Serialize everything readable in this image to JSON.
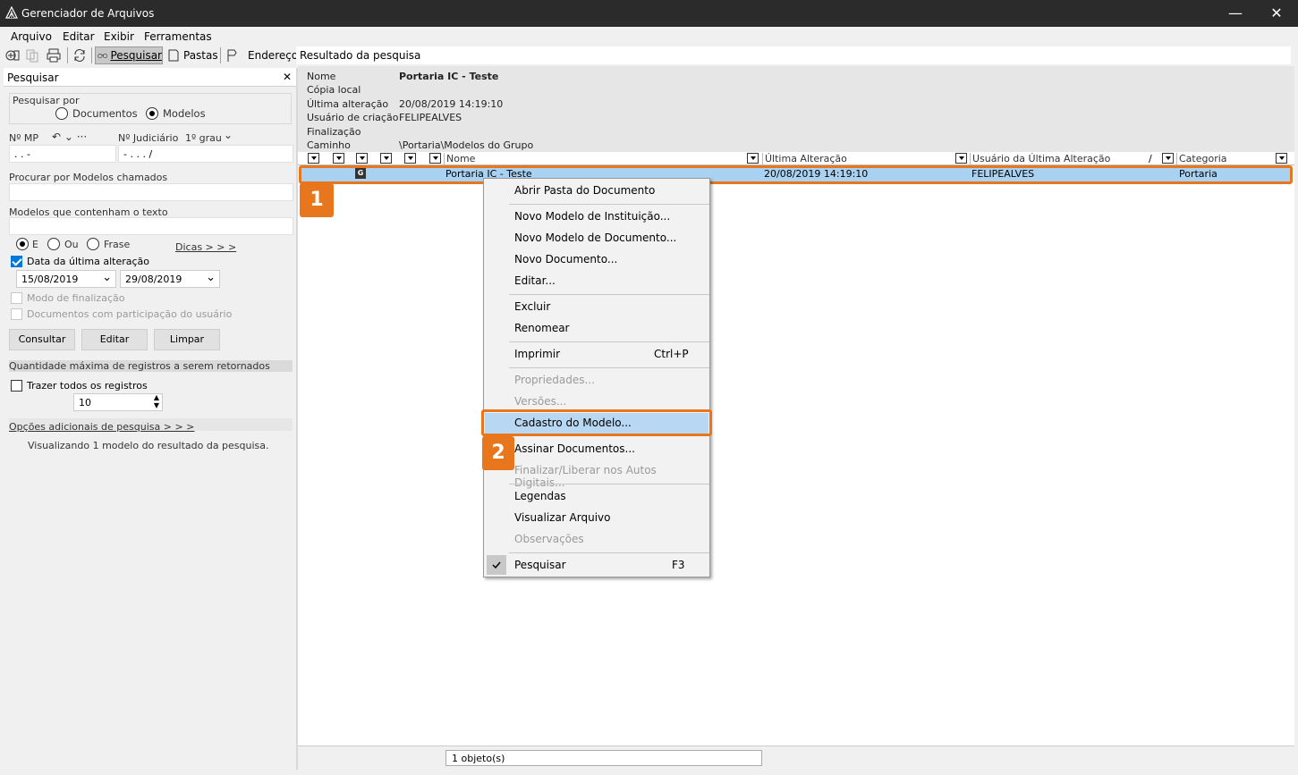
{
  "window": {
    "title": "Gerenciador de Arquivos",
    "minimize": "—",
    "close": "✕"
  },
  "menu": [
    {
      "label": "Arquivo"
    },
    {
      "label": "Editar"
    },
    {
      "label": "Exibir"
    },
    {
      "label": "Ferramentas"
    }
  ],
  "toolbar": {
    "search": "Pesquisar",
    "folders": "Pastas",
    "address_label": "Endereço",
    "address_value": "Resultado da pesquisa"
  },
  "left": {
    "panel_title": "Pesquisar",
    "search_by": "Pesquisar por",
    "opt_documents": "Documentos",
    "opt_models": "Modelos",
    "mp_label": "Nº MP",
    "mp_value": "  .   .     -",
    "judiciario_label": "Nº Judiciário",
    "grau": "1º grau",
    "judiciario_value": "      -   .   .  .     /",
    "search_name_label": "Procurar por Modelos chamados",
    "contains_label": "Modelos que contenham o texto",
    "opt_e": "E",
    "opt_ou": "Ou",
    "opt_frase": "Frase",
    "tips": "Dicas > > >",
    "last_change_label": "Data da última alteração",
    "date_from": "15/08/2019",
    "date_to": "29/08/2019",
    "finalization_label": "Modo de finalização",
    "participation_label": "Documentos com participação do usuário",
    "btn_query": "Consultar",
    "btn_edit": "Editar",
    "btn_clear": "Limpar",
    "max_records": "Quantidade máxima de registros a serem retornados",
    "bring_all": "Trazer todos os registros",
    "limit": "10",
    "more_options": "Opções adicionais de pesquisa > > >",
    "result_info": "Visualizando 1 modelo do resultado da pesquisa."
  },
  "info": {
    "name_k": "Nome",
    "name_v": "Portaria IC - Teste",
    "copy_k": "Cópia local",
    "last_k": "Última alteração",
    "last_v": "20/08/2019 14:19:10",
    "user_k": "Usuário de criação",
    "user_v": "FELIPEALVES",
    "final_k": "Finalização",
    "path_k": "Caminho",
    "path_v": "\\Portaria\\Modelos do Grupo"
  },
  "table": {
    "columns": [
      "Nome",
      "Última Alteração",
      "Usuário da Última Alteração",
      "Categoria"
    ],
    "rows": [
      {
        "icon": "G",
        "name": "Portaria IC - Teste",
        "date": "20/08/2019 14:19:10",
        "user": "FELIPEALVES",
        "category": "Portaria"
      }
    ]
  },
  "status": "1 objeto(s)",
  "context_menu": [
    {
      "label": "Abrir Pasta do Documento"
    },
    {
      "label": "Novo Modelo de Instituição..."
    },
    {
      "label": "Novo Modelo de Documento..."
    },
    {
      "label": "Novo Documento..."
    },
    {
      "label": "Editar..."
    },
    {
      "label": "Excluir"
    },
    {
      "label": "Renomear"
    },
    {
      "label": "Imprimir",
      "shortcut": "Ctrl+P"
    },
    {
      "label": "Propriedades..."
    },
    {
      "label": "Versões..."
    },
    {
      "label": "Cadastro do Modelo..."
    },
    {
      "label": "Assinar Documentos..."
    },
    {
      "label": "Finalizar/Liberar nos Autos Digitais..."
    },
    {
      "label": "Legendas"
    },
    {
      "label": "Visualizar Arquivo"
    },
    {
      "label": "Observações"
    },
    {
      "label": "Pesquisar",
      "shortcut": "F3"
    }
  ],
  "callouts": [
    "1",
    "2"
  ],
  "colors": {
    "accent": "#e8761c",
    "selection": "#a9d2f2",
    "titlebar": "#2b2b2b"
  }
}
